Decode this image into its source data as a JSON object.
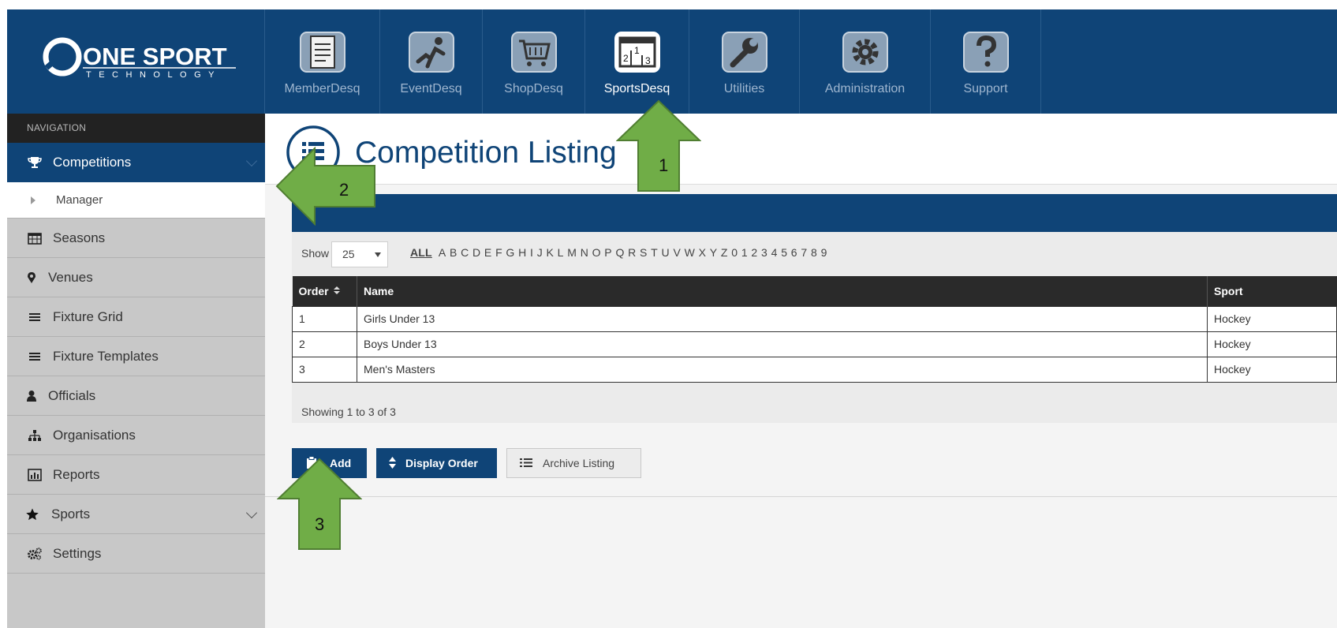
{
  "brand": {
    "name": "ONE SPORT",
    "tagline": "TECHNOLOGY"
  },
  "modules": [
    {
      "label": "MemberDesq",
      "icon": "member-list-icon"
    },
    {
      "label": "EventDesq",
      "icon": "runner-icon"
    },
    {
      "label": "ShopDesq",
      "icon": "shopping-cart-icon"
    },
    {
      "label": "SportsDesq",
      "icon": "podium-icon"
    },
    {
      "label": "Utilities",
      "icon": "wrench-icon"
    },
    {
      "label": "Administration",
      "icon": "gear-icon"
    },
    {
      "label": "Support",
      "icon": "question-icon"
    }
  ],
  "active_module": "SportsDesq",
  "sidebar": {
    "title": "NAVIGATION",
    "competitions": "Competitions",
    "manager": "Manager",
    "seasons": "Seasons",
    "venues": "Venues",
    "fixture_grid": "Fixture Grid",
    "fixture_templates": "Fixture Templates",
    "officials": "Officials",
    "organisations": "Organisations",
    "reports": "Reports",
    "sports": "Sports",
    "settings": "Settings"
  },
  "page": {
    "title": "Competition Listing",
    "show_label": "Show",
    "page_size": "25",
    "alpha_all": "ALL",
    "alpha": [
      "A",
      "B",
      "C",
      "D",
      "E",
      "F",
      "G",
      "H",
      "I",
      "J",
      "K",
      "L",
      "M",
      "N",
      "O",
      "P",
      "Q",
      "R",
      "S",
      "T",
      "U",
      "V",
      "W",
      "X",
      "Y",
      "Z",
      "0",
      "1",
      "2",
      "3",
      "4",
      "5",
      "6",
      "7",
      "8",
      "9"
    ],
    "columns": {
      "order": "Order",
      "name": "Name",
      "sport": "Sport"
    },
    "rows": [
      {
        "order": "1",
        "name": "Girls Under 13",
        "sport": "Hockey"
      },
      {
        "order": "2",
        "name": "Boys Under 13",
        "sport": "Hockey"
      },
      {
        "order": "3",
        "name": "Men's Masters",
        "sport": "Hockey"
      }
    ],
    "showing": "Showing 1 to 3 of 3"
  },
  "buttons": {
    "add": "Add",
    "display_order": "Display Order",
    "archive": "Archive Listing"
  },
  "callouts": {
    "one": "1",
    "two": "2",
    "three": "3"
  },
  "colors": {
    "brand_blue": "#0f4477",
    "arrow_green": "#70ad47",
    "arrow_border": "#507e32"
  }
}
